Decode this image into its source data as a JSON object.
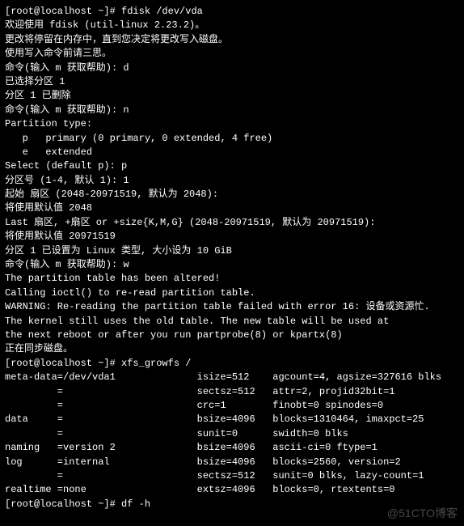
{
  "lines": [
    "[root@localhost ~]# fdisk /dev/vda",
    "欢迎使用 fdisk (util-linux 2.23.2)。",
    "",
    "更改将停留在内存中，直到您决定将更改写入磁盘。",
    "使用写入命令前请三思。",
    "",
    "",
    "命令(输入 m 获取帮助): d",
    "已选择分区 1",
    "分区 1 已删除",
    "",
    "命令(输入 m 获取帮助): n",
    "Partition type:",
    "   p   primary (0 primary, 0 extended, 4 free)",
    "   e   extended",
    "Select (default p): p",
    "分区号 (1-4, 默认 1): 1",
    "起始 扇区 (2048-20971519, 默认为 2048):",
    "将使用默认值 2048",
    "Last 扇区, +扇区 or +size{K,M,G} (2048-20971519, 默认为 20971519):",
    "将使用默认值 20971519",
    "分区 1 已设置为 Linux 类型, 大小设为 10 GiB",
    "",
    "命令(输入 m 获取帮助): w",
    "The partition table has been altered!",
    "",
    "Calling ioctl() to re-read partition table.",
    "",
    "WARNING: Re-reading the partition table failed with error 16: 设备或资源忙.",
    "The kernel still uses the old table. The new table will be used at",
    "the next reboot or after you run partprobe(8) or kpartx(8)",
    "正在同步磁盘。",
    "[root@localhost ~]# xfs_growfs /",
    "meta-data=/dev/vda1              isize=512    agcount=4, agsize=327616 blks",
    "         =                       sectsz=512   attr=2, projid32bit=1",
    "         =                       crc=1        finobt=0 spinodes=0",
    "data     =                       bsize=4096   blocks=1310464, imaxpct=25",
    "         =                       sunit=0      swidth=0 blks",
    "naming   =version 2              bsize=4096   ascii-ci=0 ftype=1",
    "log      =internal               bsize=4096   blocks=2560, version=2",
    "         =                       sectsz=512   sunit=0 blks, lazy-count=1",
    "realtime =none                   extsz=4096   blocks=0, rtextents=0",
    "[root@localhost ~]# df -h"
  ],
  "watermark": "@51CTO博客"
}
